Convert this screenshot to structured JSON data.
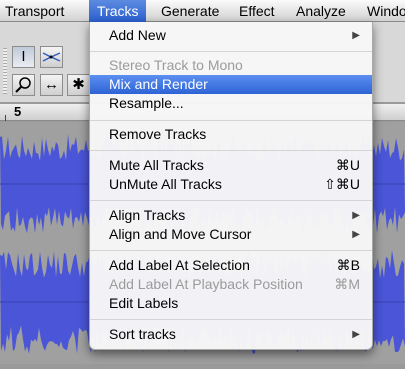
{
  "menubar": {
    "items": [
      {
        "label": "Transport"
      },
      {
        "label": "Tracks"
      },
      {
        "label": "Generate"
      },
      {
        "label": "Effect"
      },
      {
        "label": "Analyze"
      },
      {
        "label": "Windo"
      }
    ]
  },
  "toolbar": {
    "tools": [
      {
        "glyph": "I"
      },
      {
        "glyph": "✎"
      },
      {
        "glyph": "⌕"
      },
      {
        "glyph": "↔"
      },
      {
        "glyph": "✱"
      }
    ]
  },
  "ruler": {
    "number": "5"
  },
  "colors": {
    "waveform": "#4a55d8",
    "waveform_bg": "#a0a0a0",
    "highlight": "#3b6fe0"
  },
  "menu": {
    "items": [
      {
        "label": "Add New",
        "submenu": true
      },
      {
        "label": "Stereo Track to Mono",
        "disabled": true
      },
      {
        "label": "Mix and Render",
        "highlighted": true
      },
      {
        "label": "Resample..."
      },
      {
        "label": "Remove Tracks"
      },
      {
        "label": "Mute All Tracks",
        "shortcut": "⌘U"
      },
      {
        "label": "UnMute All Tracks",
        "shortcut": "⇧⌘U"
      },
      {
        "label": "Align Tracks",
        "submenu": true
      },
      {
        "label": "Align and Move Cursor",
        "submenu": true
      },
      {
        "label": "Add Label At Selection",
        "shortcut": "⌘B"
      },
      {
        "label": "Add Label At Playback Position",
        "shortcut": "⌘M",
        "disabled": true
      },
      {
        "label": "Edit Labels"
      },
      {
        "label": "Sort tracks",
        "submenu": true
      }
    ],
    "submenu_arrow": "▶"
  }
}
